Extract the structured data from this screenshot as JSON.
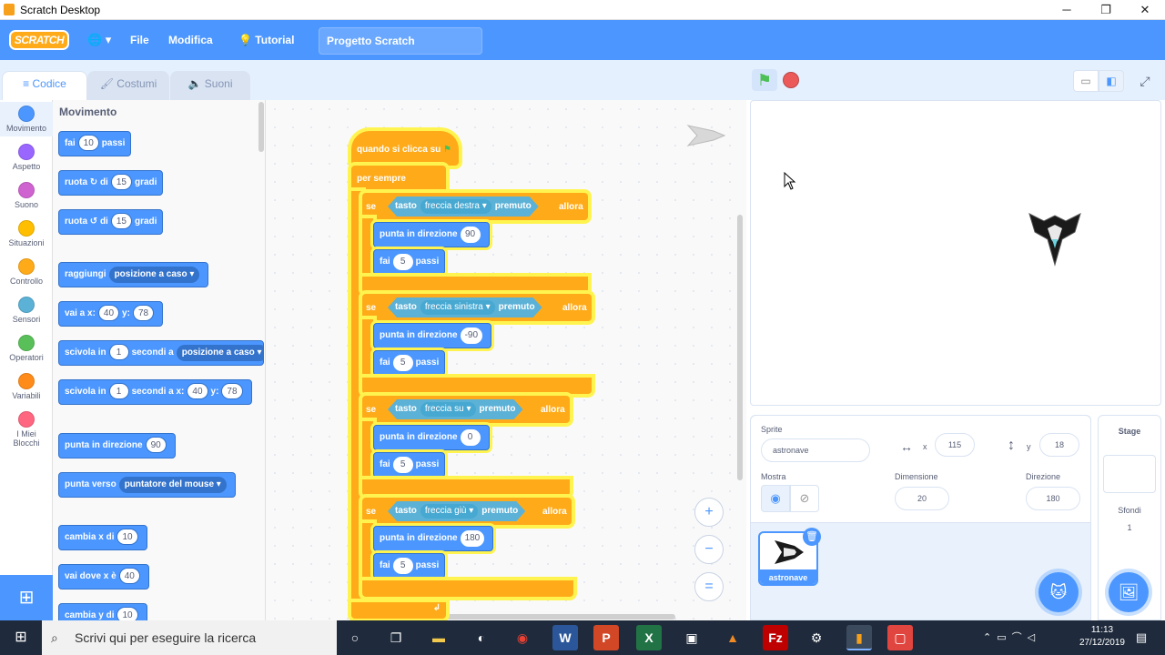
{
  "window": {
    "title": "Scratch Desktop",
    "minimize": "─",
    "restore": "❐",
    "close": "✕"
  },
  "menu": {
    "logo": "SCRATCH",
    "globe": "🌐 ▾",
    "file": "File",
    "edit": "Modifica",
    "tutorial": "Tutorial",
    "project_title": "Progetto Scratch"
  },
  "tabs": {
    "code": "Codice",
    "costumes": "Costumi",
    "sounds": "Suoni"
  },
  "categories": [
    {
      "label": "Movimento",
      "color": "#4c97ff"
    },
    {
      "label": "Aspetto",
      "color": "#9966ff"
    },
    {
      "label": "Suono",
      "color": "#cf63cf"
    },
    {
      "label": "Situazioni",
      "color": "#ffbf00"
    },
    {
      "label": "Controllo",
      "color": "#ffab19"
    },
    {
      "label": "Sensori",
      "color": "#5cb1d6"
    },
    {
      "label": "Operatori",
      "color": "#59c059"
    },
    {
      "label": "Variabili",
      "color": "#ff8c1a"
    },
    {
      "label1": "I Miei",
      "label2": "Blocchi",
      "color": "#ff6680"
    }
  ],
  "palette": {
    "header": "Movimento",
    "b1": {
      "a": "fai",
      "n": "10",
      "b": "passi"
    },
    "b2": {
      "a": "ruota",
      "b": "di",
      "n": "15",
      "c": "gradi"
    },
    "b3": {
      "a": "ruota",
      "b": "di",
      "n": "15",
      "c": "gradi"
    },
    "b4": {
      "a": "raggiungi",
      "dd": "posizione a caso ▾"
    },
    "b5": {
      "a": "vai a x:",
      "x": "40",
      "b": "y:",
      "y": "78"
    },
    "b6": {
      "a": "scivola in",
      "n": "1",
      "b": "secondi a",
      "dd": "posizione a caso ▾"
    },
    "b7": {
      "a": "scivola in",
      "n": "1",
      "b": "secondi a x:",
      "x": "40",
      "c": "y:",
      "y": "78"
    },
    "b8": {
      "a": "punta in direzione",
      "n": "90"
    },
    "b9": {
      "a": "punta verso",
      "dd": "puntatore del mouse ▾"
    },
    "b10": {
      "a": "cambia x di",
      "n": "10"
    },
    "b11": {
      "a": "vai dove x è",
      "n": "40"
    },
    "b12": {
      "a": "cambia y di",
      "n": "10"
    }
  },
  "script": {
    "hat": "quando si clicca su",
    "forever": "per sempre",
    "ifs": [
      {
        "se": "se",
        "tasto": "tasto",
        "key": "freccia destra ▾",
        "premuto": "premuto",
        "allora": "allora",
        "dir_label": "punta in direzione",
        "dir": "90",
        "fai": "fai",
        "steps": "5",
        "passi": "passi"
      },
      {
        "se": "se",
        "tasto": "tasto",
        "key": "freccia sinistra ▾",
        "premuto": "premuto",
        "allora": "allora",
        "dir_label": "punta in direzione",
        "dir": "-90",
        "fai": "fai",
        "steps": "5",
        "passi": "passi"
      },
      {
        "se": "se",
        "tasto": "tasto",
        "key": "freccia su ▾",
        "premuto": "premuto",
        "allora": "allora",
        "dir_label": "punta in direzione",
        "dir": "0",
        "fai": "fai",
        "steps": "5",
        "passi": "passi"
      },
      {
        "se": "se",
        "tasto": "tasto",
        "key": "freccia giù ▾",
        "premuto": "premuto",
        "allora": "allora",
        "dir_label": "punta in direzione",
        "dir": "180",
        "fai": "fai",
        "steps": "5",
        "passi": "passi"
      }
    ],
    "loop_arrow": "↲"
  },
  "zoom": {
    "in": "+",
    "out": "−",
    "reset": "="
  },
  "sprite_info": {
    "sprite_label": "Sprite",
    "sprite_name": "astronave",
    "x_label": "x",
    "x": "115",
    "y_label": "y",
    "y": "18",
    "show_label": "Mostra",
    "size_label": "Dimensione",
    "size": "20",
    "dir_label": "Direzione",
    "direction": "180"
  },
  "sprite_tile": {
    "name": "astronave"
  },
  "stage_panel": {
    "title": "Stage",
    "backdrops_label": "Sfondi",
    "backdrops_count": "1"
  },
  "taskbar": {
    "search_placeholder": "Scrivi qui per eseguire la ricerca",
    "time": "11:13",
    "date": "27/12/2019"
  }
}
